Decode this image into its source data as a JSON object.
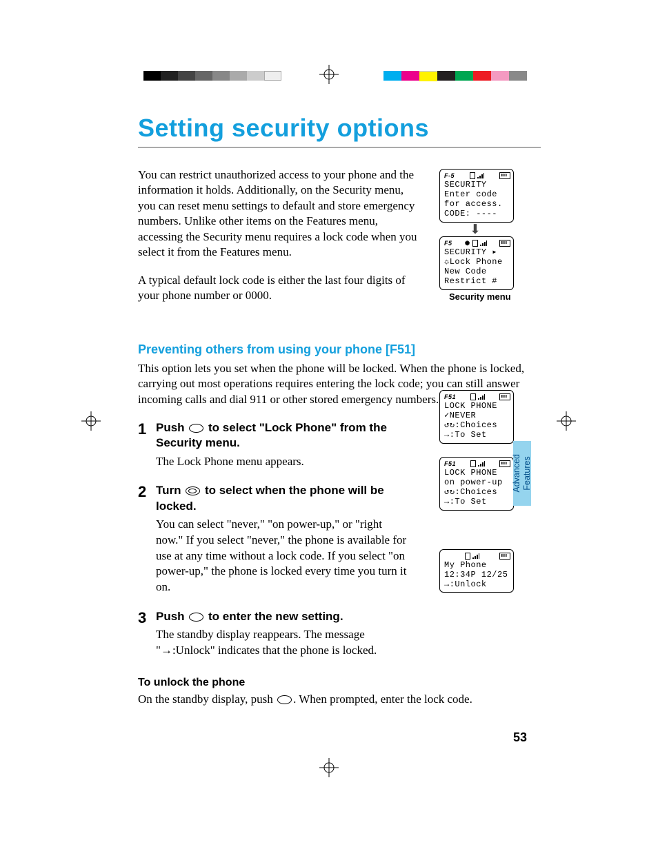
{
  "title": "Setting security options",
  "intro": {
    "p1": "You can restrict unauthorized access to your phone and the information it holds. Additionally, on the Security menu, you can reset menu settings to default and store emergency numbers. Unlike other items on the Features menu, accessing the Security menu requires a lock code when you select it from the Features menu.",
    "p2": "A typical default lock code is either the last four digits of your phone number or 0000."
  },
  "security_caption": "Security menu",
  "screens": {
    "enter_code": {
      "id": "F-5",
      "l1": "SECURITY",
      "l2": "Enter code",
      "l3": "for access.",
      "l4": " CODE: ----"
    },
    "sec_menu": {
      "id": "F5",
      "l1": "SECURITY  ▸",
      "l2": "☼Lock Phone",
      "l3": " New Code",
      "l4": " Restrict #"
    },
    "lock_never": {
      "id": "F51",
      "l1": "LOCK PHONE",
      "l2": "     ✓NEVER",
      "l3": "↺↻:Choices",
      "l4": "→:To Set"
    },
    "lock_pu": {
      "id": "F51",
      "l1": "LOCK PHONE",
      "l2": " on power-up",
      "l3": "↺↻:Choices",
      "l4": "→:To Set"
    },
    "standby": {
      "id": "",
      "l1": "My Phone",
      "l2": "12:34P 12/25",
      "l3": " ",
      "l4": "→:Unlock"
    }
  },
  "section": {
    "heading": "Preventing others from using your phone [F51]",
    "lead": "This option lets you set when the phone will be locked. When the phone is locked, carrying out most operations requires entering the lock code; you can still answer incoming calls and dial 911 or other stored emergency numbers."
  },
  "steps": [
    {
      "n": "1",
      "h_before": "Push ",
      "h_after": " to select \"Lock Phone\" from the Security menu.",
      "p": "The Lock Phone menu appears."
    },
    {
      "n": "2",
      "h_before": "Turn ",
      "h_after": " to select when the phone will be locked.",
      "p": "You can select \"never,\" \"on power-up,\" or \"right now.\" If you select \"never,\" the phone is available for use at any time without a lock code. If you select \"on power-up,\" the phone is locked every time you turn it on."
    },
    {
      "n": "3",
      "h_before": "Push ",
      "h_after": " to enter the new setting.",
      "p": "The standby display reappears. The message \"→:Unlock\" indicates that the phone is locked."
    }
  ],
  "unlock": {
    "h": "To unlock the phone",
    "before": "On the standby display, push ",
    "after": ". When prompted, enter the lock code."
  },
  "sidetab": "Advanced\nFeatures",
  "page_number": "53"
}
